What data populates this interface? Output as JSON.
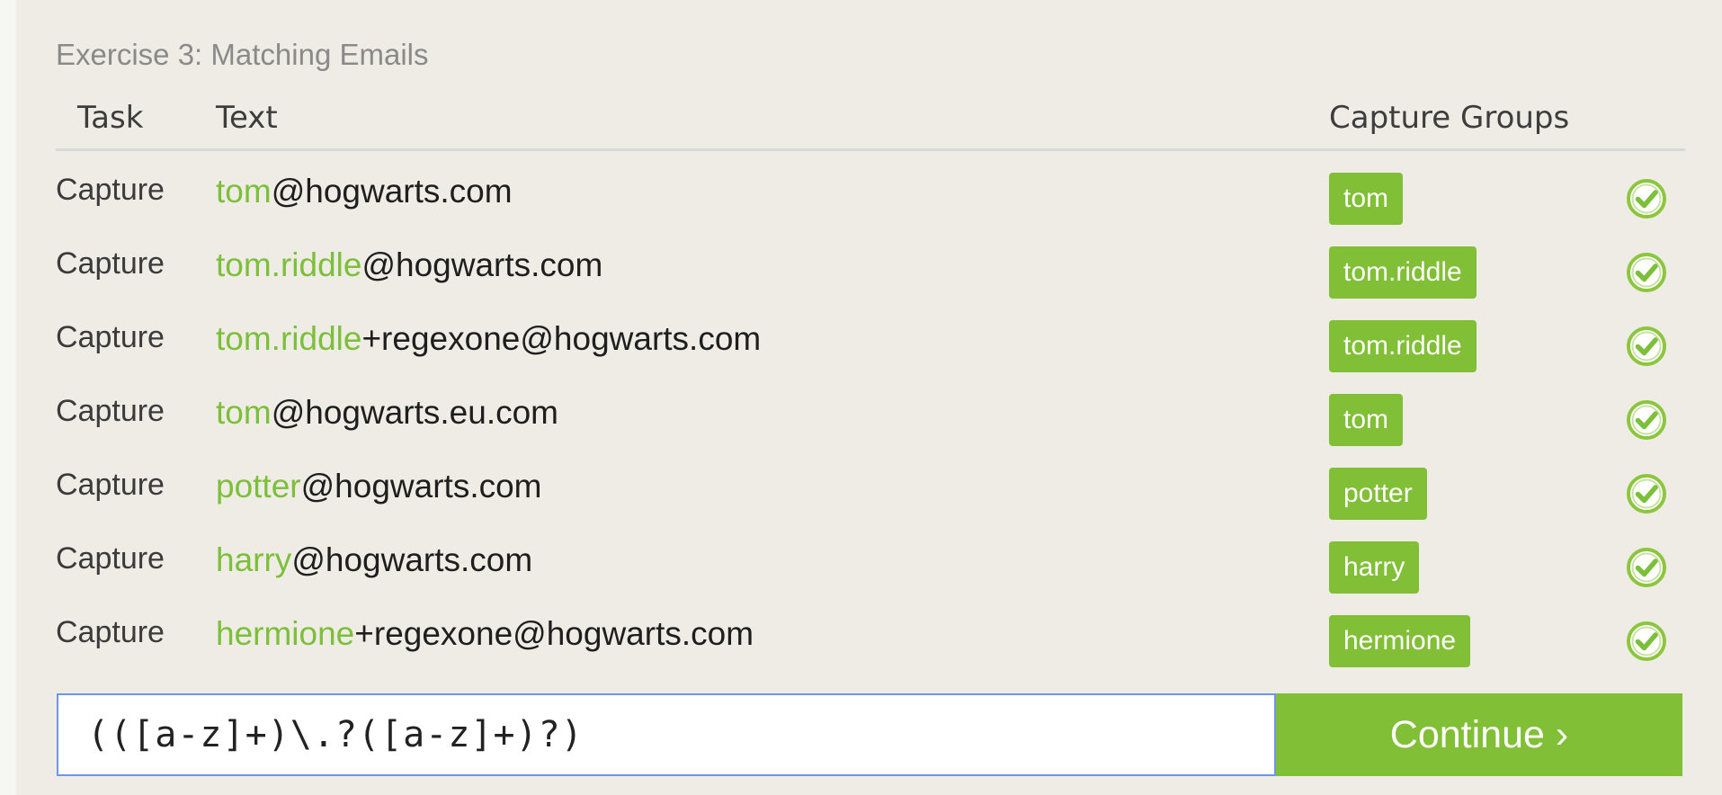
{
  "exercise": {
    "title": "Exercise 3: Matching Emails"
  },
  "table": {
    "headers": {
      "task": "Task",
      "text": "Text",
      "capture_groups": "Capture Groups"
    },
    "rows": [
      {
        "task": "Capture",
        "match": "tom",
        "rest": "@hogwarts.com",
        "group": "tom",
        "status": "check-circle-icon"
      },
      {
        "task": "Capture",
        "match": "tom.riddle",
        "rest": "@hogwarts.com",
        "group": "tom.riddle",
        "status": "check-circle-icon"
      },
      {
        "task": "Capture",
        "match": "tom.riddle",
        "rest": "+regexone@hogwarts.com",
        "group": "tom.riddle",
        "status": "check-circle-icon"
      },
      {
        "task": "Capture",
        "match": "tom",
        "rest": "@hogwarts.eu.com",
        "group": "tom",
        "status": "check-circle-icon"
      },
      {
        "task": "Capture",
        "match": "potter",
        "rest": "@hogwarts.com",
        "group": "potter",
        "status": "check-circle-icon"
      },
      {
        "task": "Capture",
        "match": "harry",
        "rest": "@hogwarts.com",
        "group": "harry",
        "status": "check-circle-icon"
      },
      {
        "task": "Capture",
        "match": "hermione",
        "rest": "+regexone@hogwarts.com",
        "group": "hermione",
        "status": "check-circle-icon"
      }
    ]
  },
  "answer": {
    "regex_value": "(([a-z]+)\\.?([a-z]+)?)",
    "continue_label": "Continue ›"
  },
  "colors": {
    "accent_green": "#81bf37",
    "match_text_green": "#7cbf3a",
    "input_border_blue": "#6d96e8",
    "background": "#efece6"
  }
}
